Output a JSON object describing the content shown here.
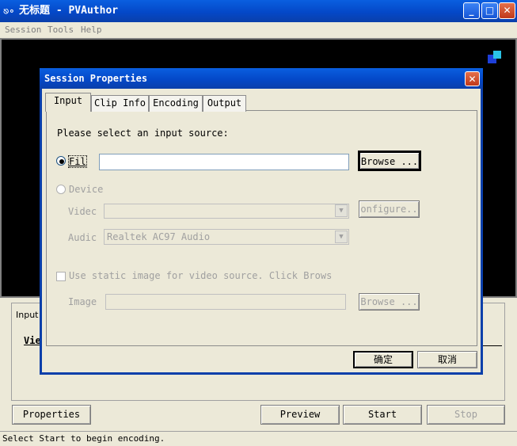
{
  "window": {
    "title": "无标题 - PVAuthor",
    "icon": "film-icon",
    "minimize": "_",
    "maximize": "□",
    "close": "✕"
  },
  "menu": {
    "items": [
      "Session",
      "Tools",
      "Help"
    ]
  },
  "dialog": {
    "title": "Session Properties",
    "close": "✕",
    "tabs": [
      "Input",
      "Clip Info",
      "Encoding",
      "Output"
    ],
    "prompt": "Please select an input source:",
    "file_label": "Fil",
    "file_value": "",
    "browse_label": "Browse ...",
    "device_label": "Device",
    "video_label": "Videc",
    "video_value": "",
    "configure_label": "onfigure..",
    "audio_label": "Audic",
    "audio_value": "Realtek AC97 Audio",
    "static_image_label": "Use static image for video source. Click Brows",
    "image_label": "Image",
    "image_value": "",
    "browse2_label": "Browse ...",
    "ok_label": "确定",
    "cancel_label": "取消"
  },
  "lower": {
    "tab_label": "Input",
    "video_label": "Vie"
  },
  "buttons": {
    "properties": "Properties",
    "preview": "Preview",
    "start": "Start",
    "stop": "Stop"
  },
  "status": {
    "text": "Select Start to begin encoding."
  }
}
